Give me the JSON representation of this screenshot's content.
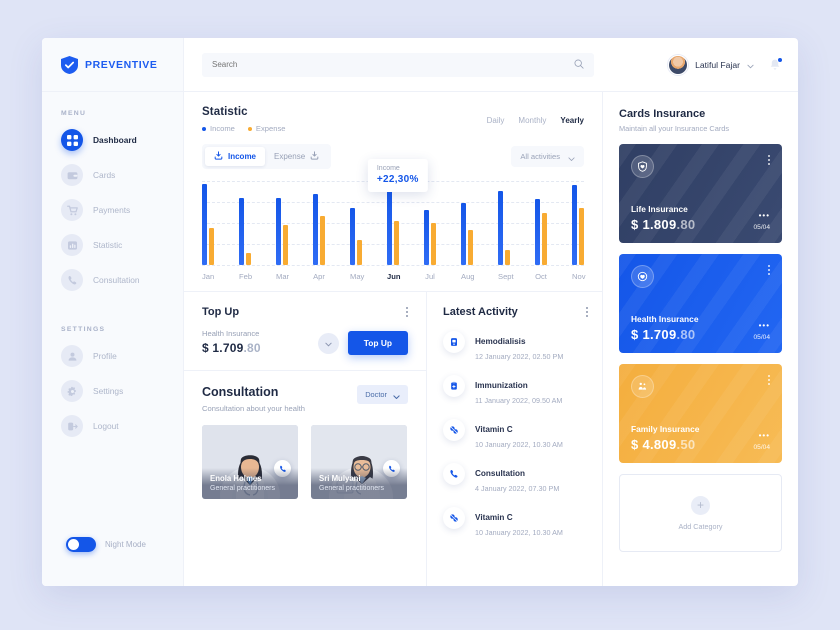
{
  "brand": {
    "name": "PREVENTIVE",
    "icon": "shield-check-icon",
    "color": "#1d5cf0"
  },
  "sidebar": {
    "menu_label": "MENU",
    "settings_label": "SETTINGS",
    "menu_items": [
      {
        "label": "Dashboard",
        "icon": "grid-icon",
        "active": true
      },
      {
        "label": "Cards",
        "icon": "wallet-icon",
        "active": false
      },
      {
        "label": "Payments",
        "icon": "cart-icon",
        "active": false
      },
      {
        "label": "Statistic",
        "icon": "chart-icon",
        "active": false
      },
      {
        "label": "Consultation",
        "icon": "phone-icon",
        "active": false
      }
    ],
    "settings_items": [
      {
        "label": "Profile",
        "icon": "user-icon"
      },
      {
        "label": "Settings",
        "icon": "gear-icon"
      },
      {
        "label": "Logout",
        "icon": "logout-icon"
      }
    ],
    "night_mode": {
      "label": "Night Mode",
      "enabled": true,
      "color": "#1456e8"
    }
  },
  "topbar": {
    "search": {
      "placeholder": "Search",
      "value": "",
      "icon": "search-icon"
    },
    "user": {
      "name": "Latiful Fajar",
      "chevron": "chevron-down-icon",
      "avatar": "avatar"
    },
    "notification": {
      "icon": "bell-icon",
      "has_unread": true,
      "dot_color": "#1456e8"
    }
  },
  "statistic": {
    "title": "Statistic",
    "legend": [
      {
        "label": "Income",
        "color": "#1456e8"
      },
      {
        "label": "Expense",
        "color": "#f8ab32"
      }
    ],
    "periods": [
      {
        "label": "Daily",
        "active": false
      },
      {
        "label": "Monthly",
        "active": false
      },
      {
        "label": "Yearly",
        "active": true
      }
    ],
    "segments": [
      {
        "label": "Income",
        "icon": "download-icon",
        "active": true
      },
      {
        "label": "Expense",
        "icon": "download-icon",
        "active": false
      }
    ],
    "filter": {
      "label": "All activities",
      "icon": "chevron-down-icon"
    },
    "tooltip": {
      "label": "Income",
      "value": "+22,30%"
    }
  },
  "chart_data": {
    "type": "bar",
    "title": "Statistic",
    "xlabel": "",
    "ylabel": "",
    "grid": true,
    "legend_position": "top-left",
    "ylim": [
      0,
      100
    ],
    "categories": [
      "Jan",
      "Feb",
      "Mar",
      "Apr",
      "May",
      "Jun",
      "Jul",
      "Aug",
      "Sept",
      "Oct",
      "Nov"
    ],
    "highlight_category": "Jun",
    "series": [
      {
        "name": "Income",
        "color": "#1456e8",
        "values": [
          96,
          80,
          80,
          85,
          68,
          97,
          66,
          74,
          88,
          78,
          95
        ]
      },
      {
        "name": "Expense",
        "color": "#f8ab32",
        "values": [
          44,
          14,
          48,
          58,
          30,
          52,
          50,
          42,
          18,
          62,
          68
        ]
      }
    ]
  },
  "topup": {
    "title": "Top Up",
    "kebab": "more-options-icon",
    "plan_label": "Health Insurance",
    "amount_main": "$ 1.709",
    "amount_cents": ".80",
    "expand_icon": "chevron-down-icon",
    "button_label": "Top Up"
  },
  "consultation": {
    "title": "Consultation",
    "subtitle": "Consultation about your health",
    "filter": {
      "label": "Doctor",
      "icon": "chevron-down-icon"
    },
    "doctors": [
      {
        "name": "Enola Holmes",
        "role": "General practitioners",
        "call_icon": "phone-icon"
      },
      {
        "name": "Sri Mulyani",
        "role": "General practitioners",
        "call_icon": "phone-icon"
      }
    ]
  },
  "latest_activity": {
    "title": "Latest Activity",
    "kebab": "more-options-icon",
    "items": [
      {
        "title": "Hemodialisis",
        "date": "12 January 2022, 02.50 PM",
        "icon": "dialysis-icon"
      },
      {
        "title": "Immunization",
        "date": "11 January 2022, 09.50 AM",
        "icon": "clipboard-icon"
      },
      {
        "title": "Vitamin C",
        "date": "10 January 2022, 10.30 AM",
        "icon": "pills-icon"
      },
      {
        "title": "Consultation",
        "date": "4 January 2022, 07.30 PM",
        "icon": "phone-icon"
      },
      {
        "title": "Vitamin C",
        "date": "10 January 2022, 10.30 AM",
        "icon": "pills-icon"
      }
    ]
  },
  "cards_insurance": {
    "title": "Cards Insurance",
    "subtitle": "Maintain all your Insurance Cards",
    "cards": [
      {
        "name": "Life Insurance",
        "amount_main": "$ 1.809",
        "amount_cents": ".80",
        "expiry": "05/04",
        "dots": "•••",
        "icon": "shield-heart-icon",
        "color": "#303f64",
        "color2": "#3a4a71",
        "kebab": "more-options-icon"
      },
      {
        "name": "Health Insurance",
        "amount_main": "$ 1.709",
        "amount_cents": ".80",
        "expiry": "05/04",
        "dots": "•••",
        "icon": "heartbeat-icon",
        "color": "#1456e8",
        "color2": "#2266f2",
        "kebab": "more-options-icon"
      },
      {
        "name": "Family Insurance",
        "amount_main": "$ 4.809",
        "amount_cents": ".50",
        "expiry": "05/04",
        "dots": "•••",
        "icon": "family-icon",
        "color": "#f4ae3e",
        "color2": "#f7bb55",
        "kebab": "more-options-icon"
      }
    ],
    "add_category": {
      "label": "Add Category",
      "icon": "plus-icon"
    }
  }
}
